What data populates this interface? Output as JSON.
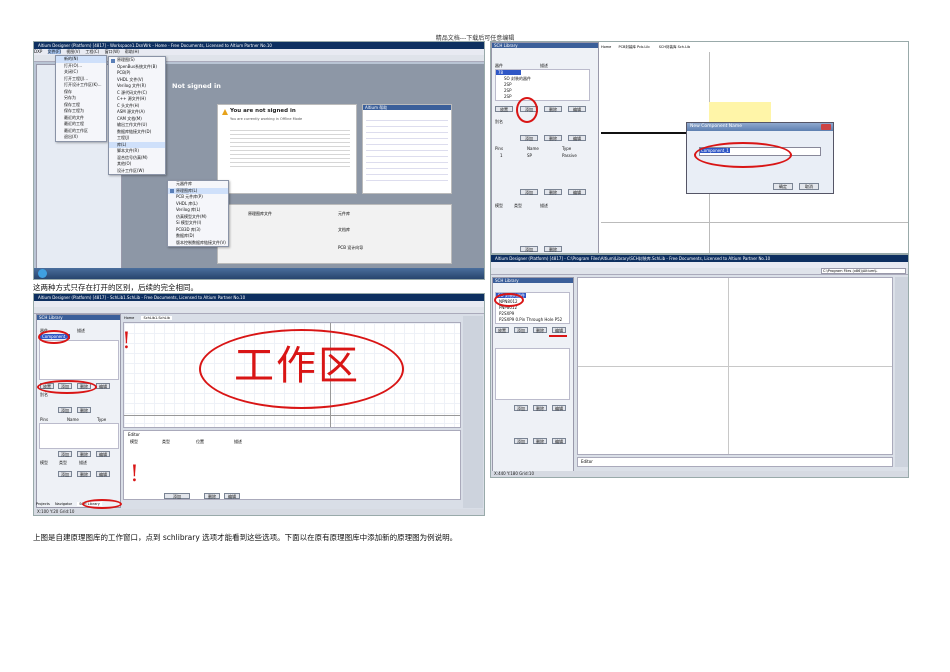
{
  "doc": {
    "header_note": "精品文档---下载后可任意编辑",
    "caption1": "这两种方式只存在打开的区别，后续的完全相同。",
    "caption2": "上图是自建原理图库的工作窗口，点到 schlibrary 选项才能看到这些选项。下面以在原有原理图库中添加新的原理图为例说明。"
  },
  "shot1": {
    "title": "Altium Designer (Platform) [4817] - Workspace1.DsnWrk - Home - Free Documents, Licensed to Altium Partner No.10",
    "menus": [
      "DXP",
      "文件(F)",
      "视图(V)",
      "工程(C)",
      "窗口(W)",
      "帮助(H)"
    ],
    "not_signed_banner": "Not signed in",
    "warning_title": "You are not signed in",
    "warning_sub": "You are currently working in Offline Mode",
    "file_menu": [
      "新的(N)",
      "打开(O)...",
      "关闭(C)",
      "打开工程(J)...",
      "打开设计工作区(K)...",
      "保存",
      "另存为",
      "保存工程",
      "保存工程为",
      "最近的文件",
      "最近的工程",
      "最近的工作区",
      "退出(X)"
    ],
    "new_submenu": [
      "原理图(S)",
      "OpenBus系统文件(B)",
      "PCB(P)",
      "VHDL 文件(V)",
      "Verilog 文件(R)",
      "C 源代码文件(C)",
      "C++ 源文件(H)",
      "C 头文件(H)",
      "ASM 源文件(A)",
      "CAM 文档(M)",
      "输出工作文件(U)",
      "数据库链接文件(D)",
      "工程(J)",
      "库(L)",
      "脚本文件(R)",
      "混合信号仿真(M)",
      "其他(O)",
      "设计工作区(W)"
    ],
    "lib_submenu": [
      "元器件库",
      "原理图库(L)",
      "PCB 元件库(P)",
      "VHDL 库(L)",
      "Verilog 库(L)",
      "仿真模型文件(M)",
      "Si 模型文件(I)",
      "PCB3D 库(3)",
      "数据库(D)",
      "版本控制数据库链接文件(V)"
    ],
    "right_panel_title": "Altium 帮助",
    "tiles": [
      "原理图库文件",
      "元件库",
      "文档库",
      "PCB 设计向导"
    ]
  },
  "shot2": {
    "title": "Altium Designer (Platform) [4817] - SchLib1.SchLib - Free Documents, Licensed to Altium Partner No.10",
    "panel_title": "SCH Library",
    "col_component": "器件",
    "col_desc": "描述",
    "comp_item": "Component_1",
    "btn_place": "放置",
    "btn_add": "添加",
    "btn_delete": "删除",
    "btn_edit": "编辑",
    "alias_label": "别名",
    "pins_cols": [
      "Pins",
      "Name",
      "Type"
    ],
    "model_cols": [
      "模型",
      "类型",
      "描述"
    ],
    "editor_cols": [
      "模型",
      "类型",
      "位置",
      "描述"
    ],
    "tab_home": "Home",
    "tab_schlib": "SchLib1.SchLib",
    "annotation": "工作区",
    "bottom_tabs": [
      "Projects",
      "Navigator",
      "SCH Library"
    ],
    "status": "X:100 Y:20   Grid:10",
    "editor_label": "Editor"
  },
  "shot3": {
    "panel_title": "SCH Library",
    "col_component": "器件",
    "col_desc": "描述",
    "items": [
      "78",
      "SO 封装的器件",
      "2SP",
      "2SP",
      "2SP"
    ],
    "btn_place": "放置",
    "btn_add": "添加",
    "btn_delete": "删除",
    "btn_edit": "编辑",
    "alias_label": "别名",
    "pins": {
      "cols": [
        "Pins",
        "Name",
        "Type"
      ],
      "row": [
        "1",
        "SP",
        "Passive"
      ]
    },
    "model_cols": [
      "模型",
      "类型",
      "描述"
    ],
    "tab_home": "Home",
    "tab_pcb": "PCB封装库 Pcb.Lib",
    "tab_sch": "SCH封装库 Sch.Lib",
    "dialog_title": "New Component Name",
    "dialog_value": "Component_1",
    "dialog_ok": "确定",
    "dialog_cancel": "取消"
  },
  "shot4": {
    "title": "Altium Designer (Platform) [4817] - C:\\Program Files\\Altium\\Library\\SCH封装库.SchLib - Free Documents, Licensed to Altium Partner No.10",
    "path": "C:\\Program Files (x86)\\Altium\\L",
    "panel_title": "SCH Library",
    "items": [
      "SO 封装的器件",
      "NPN8012",
      "PNP8012",
      "P2SXP9",
      "P2SXP9  0.Pin Through Hole P52"
    ],
    "btn_place": "放置",
    "btn_add": "添加",
    "btn_delete": "删除",
    "btn_edit": "编辑",
    "editor_label": "Editor",
    "status": "X:440 Y:180   Grid:10"
  }
}
